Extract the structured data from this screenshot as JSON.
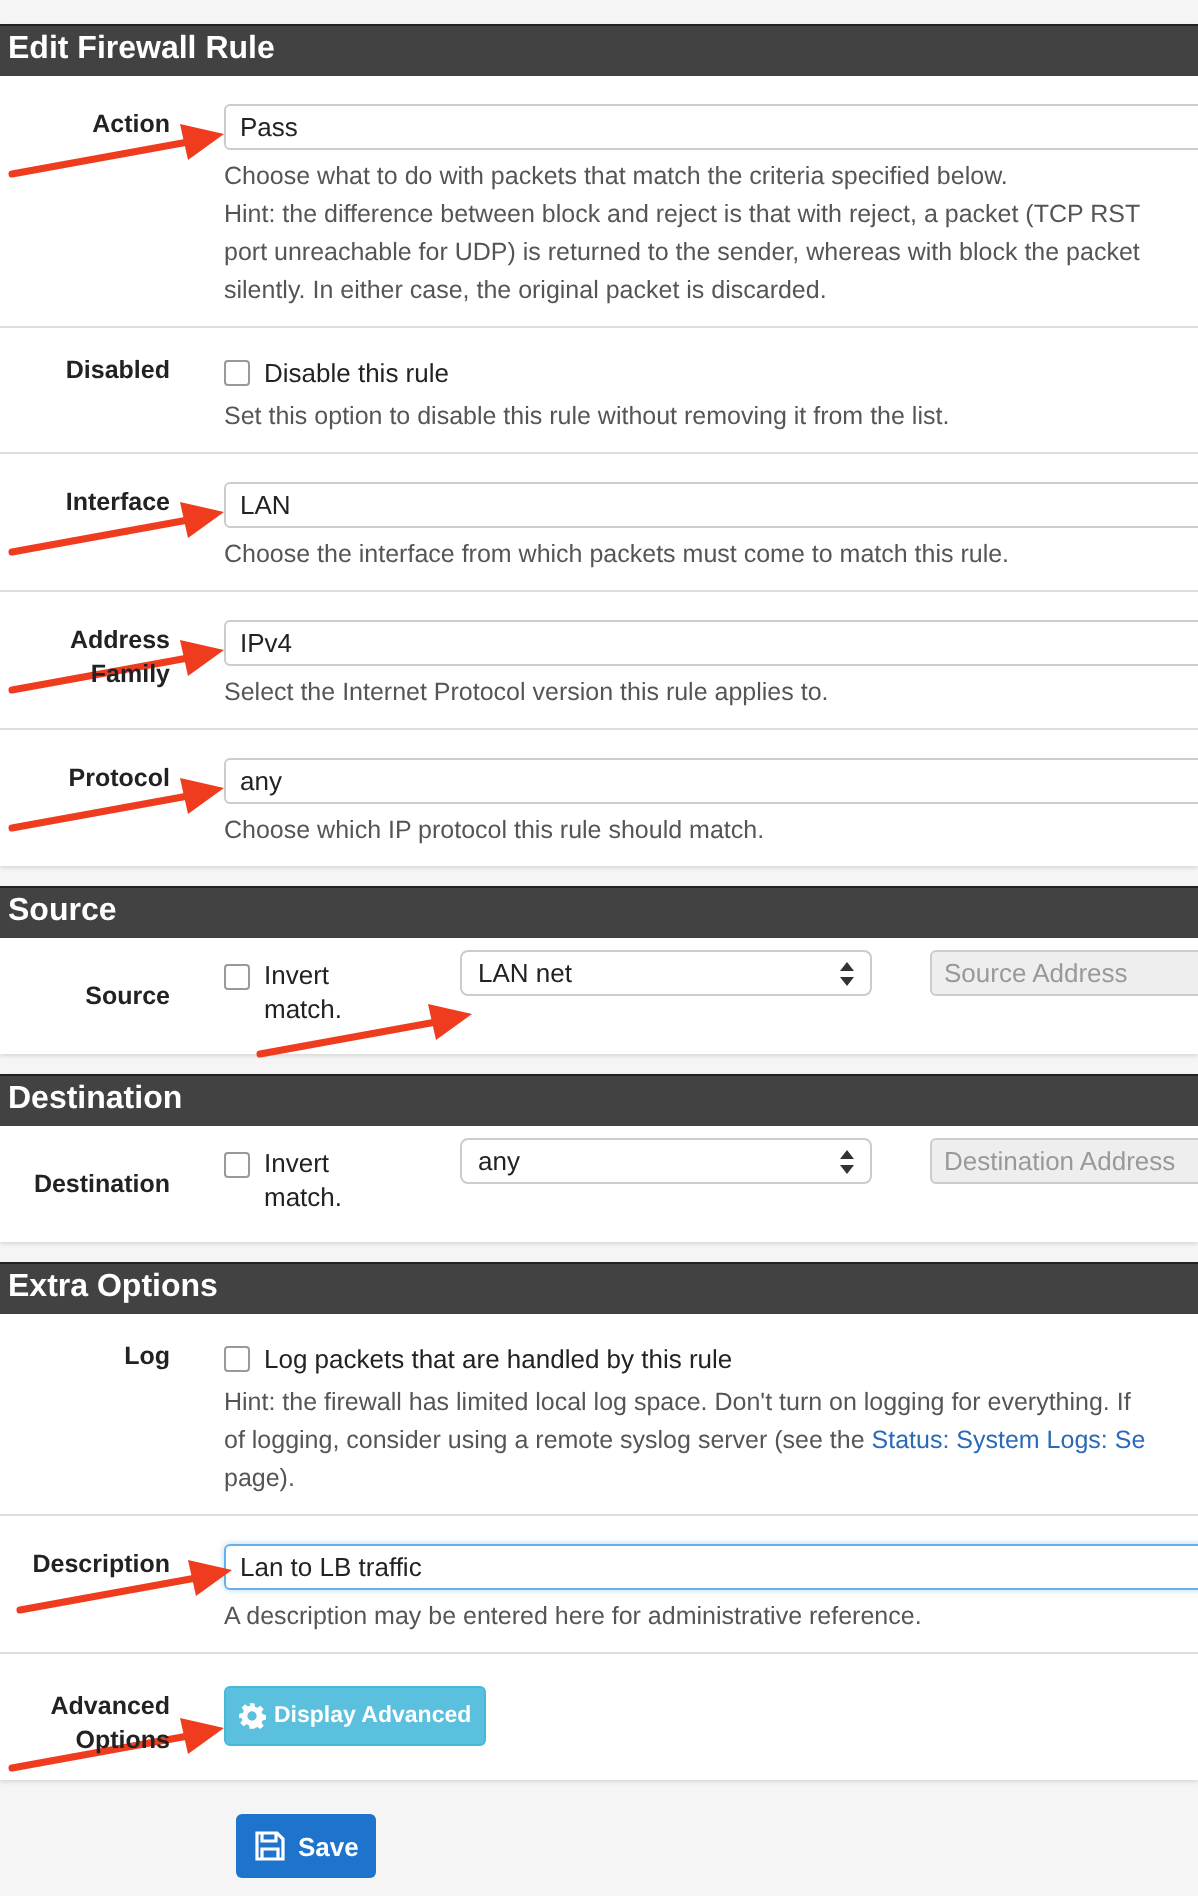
{
  "sections": [
    {
      "title": "Edit Firewall Rule",
      "rows": [
        {
          "kind": "select",
          "label": "Action",
          "value": "Pass",
          "arrow": true,
          "help": [
            "Choose what to do with packets that match the criteria specified below.",
            "Hint: the difference between block and reject is that with reject, a packet (TCP RST",
            "port unreachable for UDP) is returned to the sender, whereas with block the packet",
            "silently. In either case, the original packet is discarded."
          ]
        },
        {
          "kind": "checkbox",
          "label": "Disabled",
          "text": "Disable this rule",
          "checked": false,
          "arrow": false,
          "help": [
            "Set this option to disable this rule without removing it from the list."
          ]
        },
        {
          "kind": "select",
          "label": "Interface",
          "value": "LAN",
          "arrow": true,
          "help": [
            "Choose the interface from which packets must come to match this rule."
          ]
        },
        {
          "kind": "select",
          "label": "Address Family",
          "value": "IPv4",
          "arrow": true,
          "help": [
            "Select the Internet Protocol version this rule applies to."
          ]
        },
        {
          "kind": "select",
          "label": "Protocol",
          "value": "any",
          "arrow": true,
          "help": [
            "Choose which IP protocol this rule should match."
          ]
        }
      ]
    },
    {
      "title": "Source",
      "rows": [
        {
          "kind": "endpoint",
          "label": "Source",
          "invert": {
            "text": "Invert match.",
            "checked": false
          },
          "value": "LAN net",
          "placeholder": "Source Address",
          "arrow": true
        }
      ]
    },
    {
      "title": "Destination",
      "rows": [
        {
          "kind": "endpoint",
          "label": "Destination",
          "invert": {
            "text": "Invert match.",
            "checked": false
          },
          "value": "any",
          "placeholder": "Destination Address",
          "arrow": false
        }
      ]
    },
    {
      "title": "Extra Options",
      "rows": [
        {
          "kind": "checkbox",
          "label": "Log",
          "text": "Log packets that are handled by this rule",
          "checked": false,
          "arrow": false,
          "help": [
            "Hint: the firewall has limited local log space. Don't turn on logging for everything. If",
            {
              "text": "of logging, consider using a remote syslog server (see the ",
              "link": "Status: System Logs: Se"
            },
            "page)."
          ]
        },
        {
          "kind": "text",
          "label": "Description",
          "value": "Lan to LB traffic",
          "focused": true,
          "arrow": true,
          "help": [
            "A description may be entered here for administrative reference."
          ]
        },
        {
          "kind": "button",
          "label": "Advanced Options",
          "button": "Display Advanced",
          "arrow": true
        }
      ]
    }
  ],
  "save_button": "Save"
}
